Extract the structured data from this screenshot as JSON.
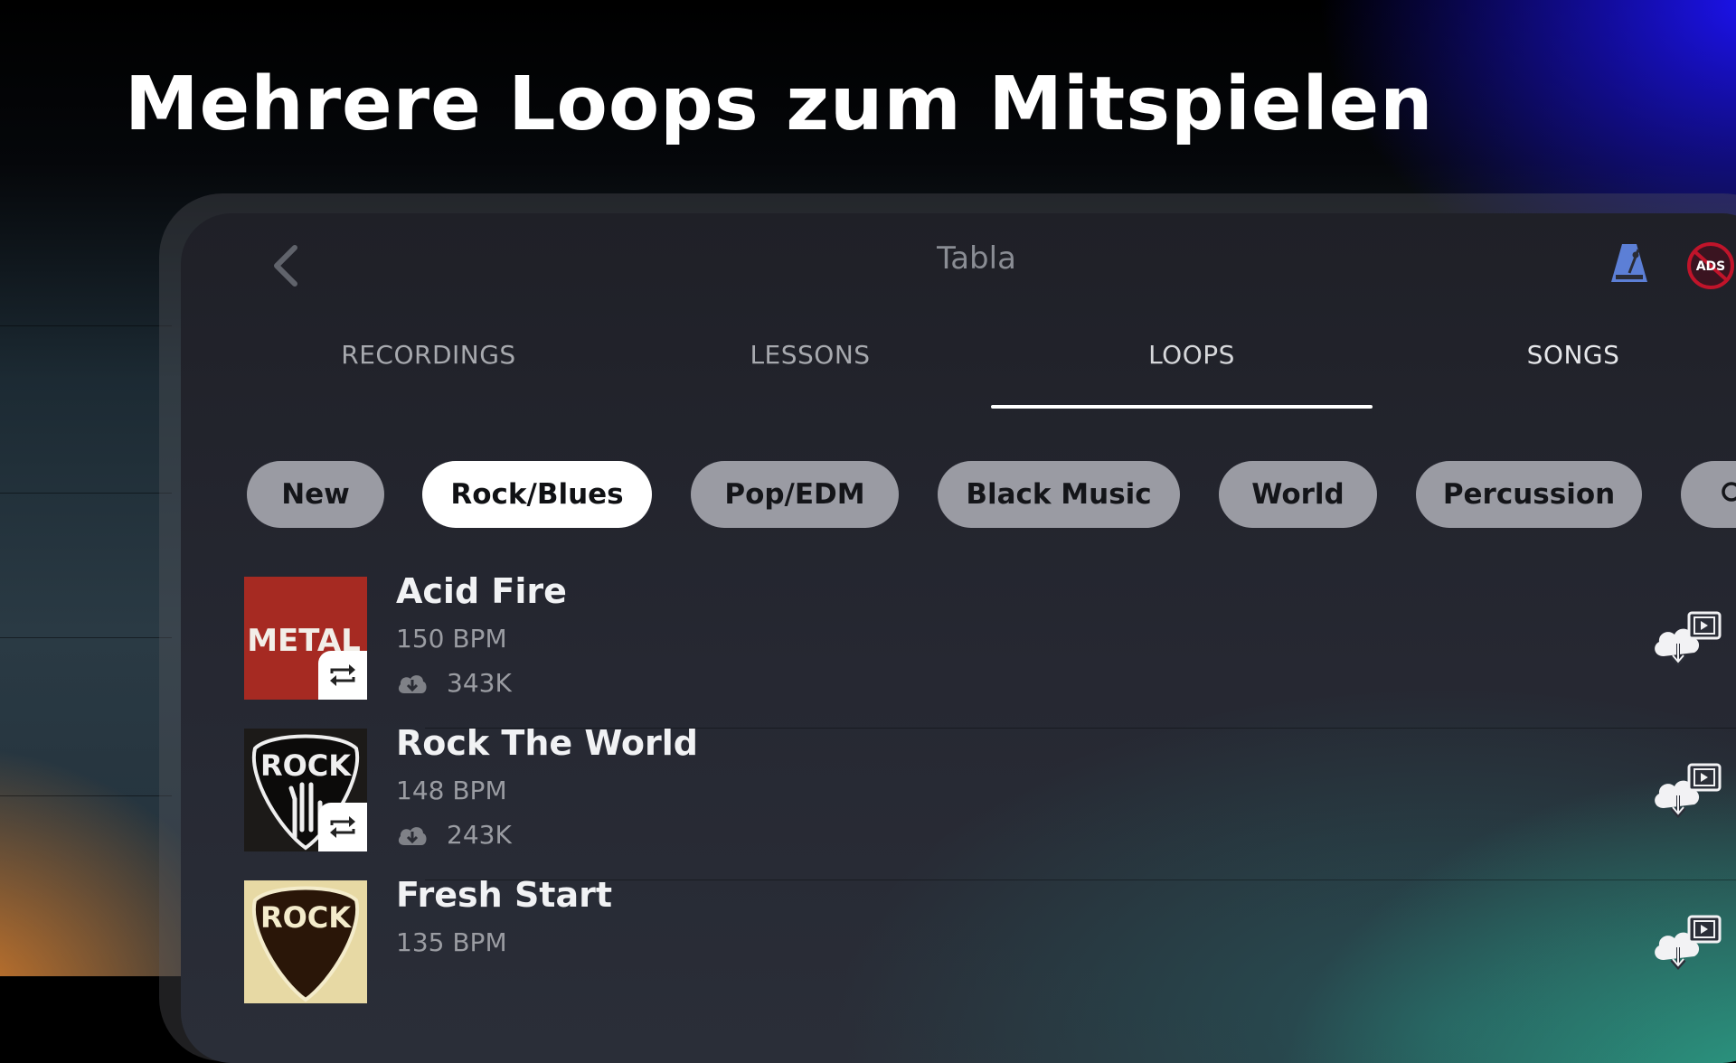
{
  "headline": "Mehrere Loops zum Mitspielen",
  "app": {
    "title": "Tabla",
    "back_icon": "chevron-left-icon",
    "metronome_icon": "metronome-icon",
    "ads_icon": "no-ads-icon",
    "ads_label": "ADS"
  },
  "tabs": [
    {
      "label": "RECORDINGS",
      "active": false
    },
    {
      "label": "LESSONS",
      "active": false
    },
    {
      "label": "LOOPS",
      "active": true
    },
    {
      "label": "SONGS",
      "active": false
    }
  ],
  "chips": [
    {
      "label": "New",
      "selected": false
    },
    {
      "label": "Rock/Blues",
      "selected": true
    },
    {
      "label": "Pop/EDM",
      "selected": false
    },
    {
      "label": "Black Music",
      "selected": false
    },
    {
      "label": "World",
      "selected": false
    },
    {
      "label": "Percussion",
      "selected": false
    }
  ],
  "loops": [
    {
      "title": "Acid Fire",
      "bpm": "150 BPM",
      "downloads": "343K",
      "cover_text": "METAL"
    },
    {
      "title": "Rock The World",
      "bpm": "148 BPM",
      "downloads": "243K",
      "cover_text": "ROCK"
    },
    {
      "title": "Fresh Start",
      "bpm": "135 BPM",
      "downloads": "",
      "cover_text": "ROCK"
    }
  ],
  "colors": {
    "accent_indicator": "#ffffff",
    "chip_default": "#9a9ba3",
    "chip_selected": "#ffffff",
    "metronome": "#5c7fd6",
    "ads_circle": "#c0142a"
  }
}
